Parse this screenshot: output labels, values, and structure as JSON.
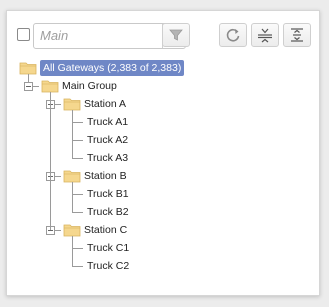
{
  "toolbar": {
    "search_placeholder": "Main",
    "clear_label": "x",
    "buttons": [
      "filter-icon",
      "refresh-icon",
      "collapse-all-icon",
      "expand-all-icon"
    ]
  },
  "tree": {
    "root": "All Gateways (2,383 of 2,383)",
    "group": "Main Group",
    "stations": [
      {
        "name": "Station A",
        "trucks": [
          "Truck A1",
          "Truck A2",
          "Truck A3"
        ]
      },
      {
        "name": "Station B",
        "trucks": [
          "Truck B1",
          "Truck B2"
        ]
      },
      {
        "name": "Station C",
        "trucks": [
          "Truck C1",
          "Truck C2"
        ]
      }
    ]
  },
  "colors": {
    "selection": "#6f87c6",
    "folder": "#f5d78e",
    "folder_border": "#d9b45f"
  }
}
